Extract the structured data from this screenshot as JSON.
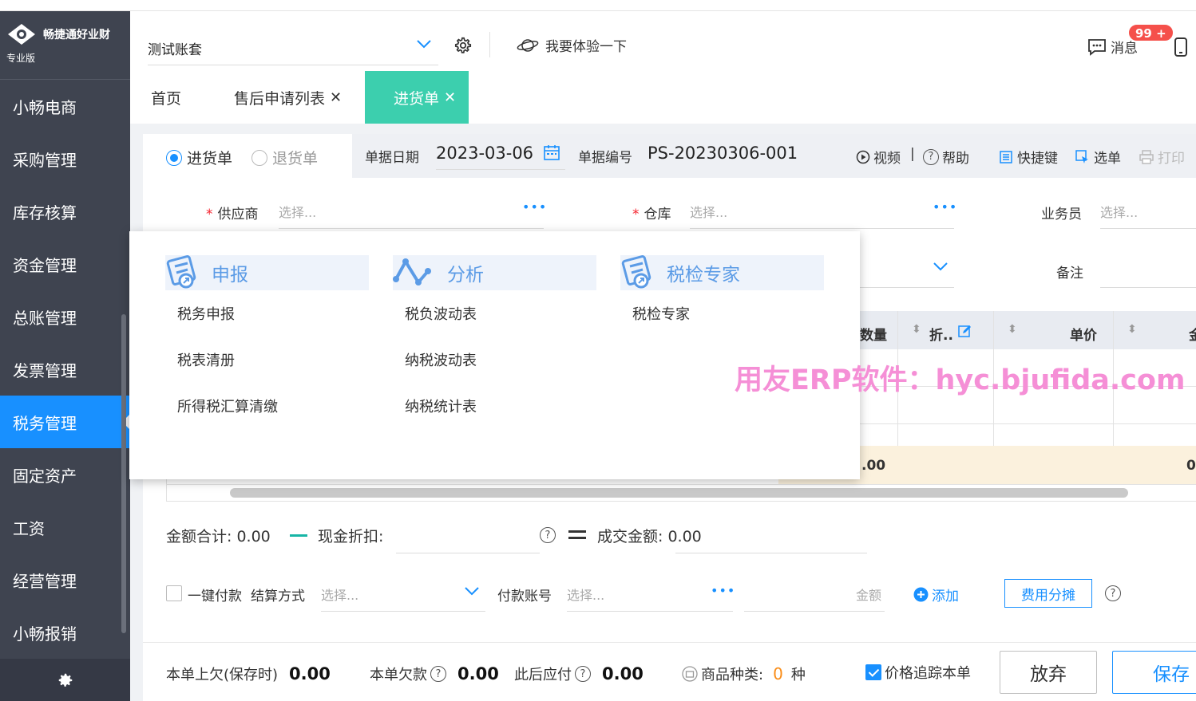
{
  "app": {
    "logo_name": "畅捷通好业财",
    "edition": "专业版"
  },
  "sidebar": {
    "items": [
      {
        "label": "小畅电商"
      },
      {
        "label": "采购管理"
      },
      {
        "label": "库存核算"
      },
      {
        "label": "资金管理"
      },
      {
        "label": "总账管理"
      },
      {
        "label": "发票管理"
      },
      {
        "label": "税务管理",
        "active": true
      },
      {
        "label": "固定资产"
      },
      {
        "label": "工资"
      },
      {
        "label": "经营管理"
      },
      {
        "label": "小畅报销"
      }
    ],
    "bottom_icon": "gear-icon"
  },
  "topbar": {
    "account": "测试账套",
    "try_label": "我要体验一下",
    "messages_label": "消息",
    "badge": "99 +"
  },
  "tabs": [
    {
      "label": "首页"
    },
    {
      "label": "售后申请列表",
      "closable": true
    },
    {
      "label": "进货单",
      "closable": true,
      "active": true
    }
  ],
  "form": {
    "type_options": [
      "进货单",
      "退货单"
    ],
    "selected_type": "进货单",
    "date_label": "单据日期",
    "date_value": "2023-03-06",
    "number_label": "单据编号",
    "number_value": "PS-20230306-001",
    "tools": {
      "video": "视频",
      "help": "帮助",
      "shortcut": "快捷键",
      "select": "选单",
      "print": "打印"
    },
    "supplier_label": "供应商",
    "supplier_placeholder": "选择...",
    "warehouse_label": "仓库",
    "warehouse_placeholder": "选择...",
    "salesman_label": "业务员",
    "salesman_placeholder": "选择...",
    "remark_label": "备注"
  },
  "table": {
    "columns": [
      "数量",
      "折..",
      "单价",
      "金"
    ],
    "sum_row": [
      ".00",
      "0"
    ]
  },
  "totals": {
    "amount_label": "金额合计:",
    "amount_value": "0.00",
    "discount_label": "现金折扣:",
    "deal_label": "成交金额:",
    "deal_value": "0.00"
  },
  "payment": {
    "one_click_label": "一键付款",
    "method_label": "结算方式",
    "method_placeholder": "选择...",
    "account_label": "付款账号",
    "account_placeholder": "选择...",
    "amount_placeholder": "金额",
    "add_label": "添加",
    "fee_button": "费用分摊"
  },
  "footer": {
    "prev_debt_label": "本单上欠(保存时)",
    "prev_debt_value": "0.00",
    "debt_label": "本单欠款",
    "debt_value": "0.00",
    "payable_label": "此后应付",
    "payable_value": "0.00",
    "types_label": "商品种类:",
    "types_value": "0",
    "types_unit": "种",
    "track_label": "价格追踪本单",
    "give_up": "放弃",
    "save": "保存"
  },
  "popup": {
    "columns": [
      {
        "title": "申报",
        "links": [
          "税务申报",
          "税表清册",
          "所得税汇算清缴"
        ]
      },
      {
        "title": "分析",
        "links": [
          "税负波动表",
          "纳税波动表",
          "纳税统计表"
        ]
      },
      {
        "title": "税检专家",
        "links": [
          "税检专家"
        ]
      }
    ]
  },
  "watermark": "用友ERP软件：hyc.bjufida.com",
  "colors": {
    "sidebar_bg": "#3f4450",
    "active_blue": "#1890ff",
    "active_tab": "#3ccfae",
    "badge": "#f5504b",
    "watermark": "#f58fd6"
  }
}
